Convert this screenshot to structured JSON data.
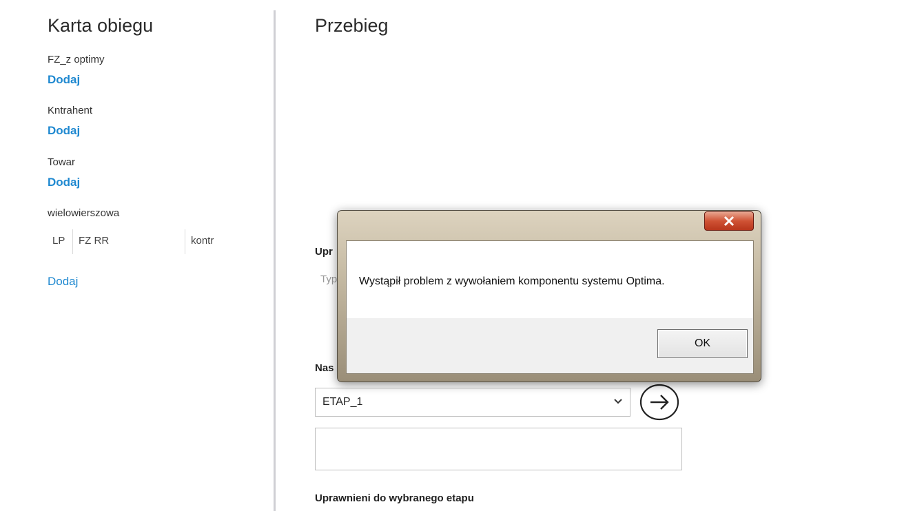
{
  "left_panel": {
    "title": "Karta obiegu",
    "fields": [
      {
        "label": "FZ_z optimy",
        "action": "Dodaj"
      },
      {
        "label": "Kntrahent",
        "action": "Dodaj"
      },
      {
        "label": "Towar",
        "action": "Dodaj"
      }
    ],
    "multirow": {
      "label": "wielowierszowa",
      "columns": [
        "LP",
        "FZ RR",
        "kontr"
      ],
      "action": "Dodaj"
    }
  },
  "right_panel": {
    "title": "Przebieg",
    "permissions_heading_partial": "Upr",
    "permissions_type_partial": "Typ",
    "next_stage_heading_partial": "Nas",
    "stage_select": {
      "value": "ETAP_1"
    },
    "go_icon": "arrow-right-circle-icon",
    "stage_permissions_heading": "Uprawnieni do wybranego etapu"
  },
  "dialog": {
    "message": "Wystąpił problem z wywołaniem komponentu systemu Optima.",
    "ok_label": "OK",
    "close_icon": "close-x-icon",
    "close_color": "#c8432a"
  },
  "colors": {
    "link": "#1e88d0",
    "divider": "#cfcfd4"
  }
}
